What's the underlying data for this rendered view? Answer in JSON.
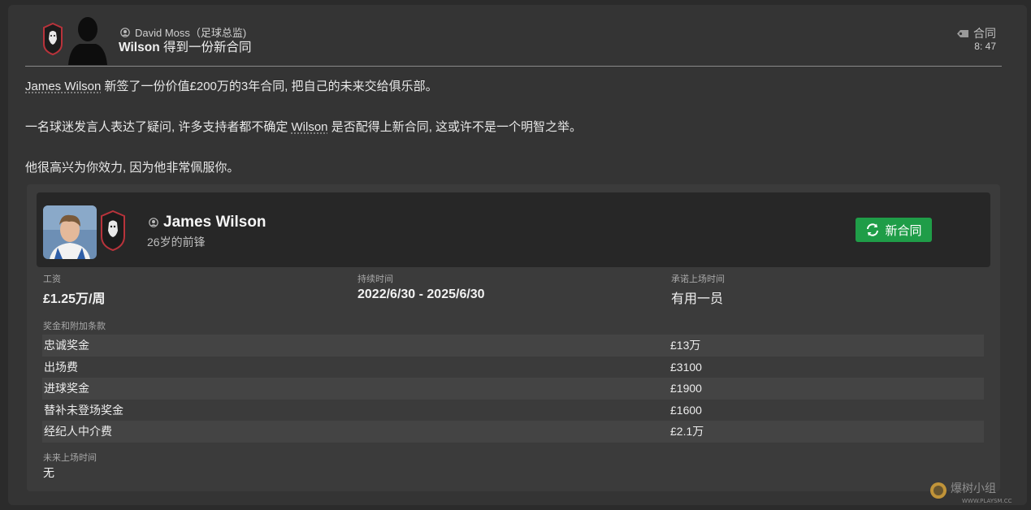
{
  "message": {
    "sender": "David Moss（足球总监)",
    "subject_bold": "Wilson",
    "subject_rest": " 得到一份新合同",
    "tag": "合同",
    "time": "8: 47"
  },
  "body": {
    "p1_name": "James Wilson",
    "p1_rest": " 新签了一份价值£200万的3年合同, 把自己的未来交给俱乐部。",
    "p2_pre": "一名球迷发言人表达了疑问, 许多支持者都不确定 ",
    "p2_name": "Wilson",
    "p2_post": " 是否配得上新合同, 这或许不是一个明智之举。",
    "p3": "他很高兴为你效力, 因为他非常佩服你。"
  },
  "card": {
    "player_name": "James Wilson",
    "player_sub": "26岁的前锋",
    "new_contract_label": "新合同",
    "wage_label": "工资",
    "wage_value": "£1.25万/周",
    "duration_label": "持续时间",
    "duration_value": "2022/6/30 - 2025/6/30",
    "promised_label": "承诺上场时间",
    "promised_value": "有用一员",
    "bonus_header": "奖金和附加条款",
    "bonuses": [
      {
        "name": "忠诚奖金",
        "value": "£13万"
      },
      {
        "name": "出场费",
        "value": "£3100"
      },
      {
        "name": "进球奖金",
        "value": "£1900"
      },
      {
        "name": "替补未登场奖金",
        "value": "£1600"
      },
      {
        "name": "经纪人中介费",
        "value": "£2.1万"
      }
    ],
    "future_label": "未来上场时间",
    "future_value": "无"
  },
  "watermark": {
    "text": "爆树小组",
    "url": "WWW.PLAYSM.CC"
  },
  "colors": {
    "background": "#2b2b2b",
    "panel": "#343434",
    "button_green": "#1f9d48",
    "club_red": "#b8333b"
  },
  "icons": [
    "lion-crest-icon",
    "person-silhouette-icon",
    "person-icon",
    "tag-icon",
    "refresh-icon"
  ]
}
